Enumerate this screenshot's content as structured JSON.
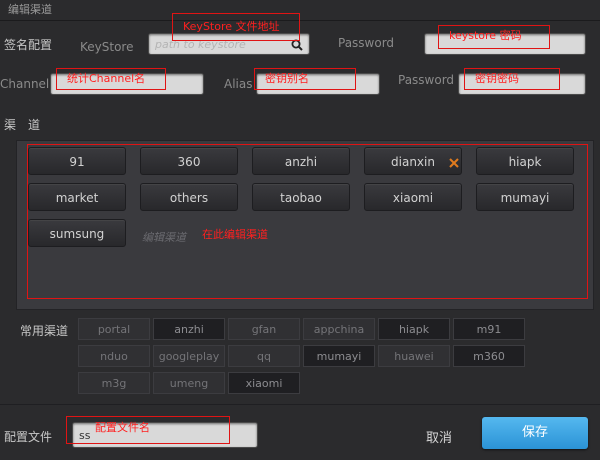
{
  "window": {
    "title": "编辑渠道"
  },
  "signing": {
    "section_label": "签名配置",
    "keystore_label": "KeyStore",
    "keystore_placeholder": "path to keystore",
    "keystore_annotation": "KeyStore 文件地址",
    "password_label": "Password",
    "password_annotation": "keystore 密码",
    "channel_label": "Channel",
    "channel_annotation": "统计Channel名",
    "alias_label": "Alias",
    "alias_annotation": "密钥别名",
    "alias_password_label": "Password",
    "alias_password_annotation": "密钥密码"
  },
  "channels": {
    "section_label": "渠　道",
    "items": [
      "91",
      "360",
      "anzhi",
      "dianxin",
      "hiapk",
      "market",
      "others",
      "taobao",
      "xiaomi",
      "mumayi",
      "sumsung"
    ],
    "edit_placeholder": "编辑渠道",
    "edit_annotation": "在此编辑渠道",
    "remove_icon": "close-icon",
    "remove_color": "#e07b1e"
  },
  "common": {
    "label": "常用渠道",
    "items": [
      {
        "name": "portal",
        "style": "light"
      },
      {
        "name": "anzhi",
        "style": "dark"
      },
      {
        "name": "gfan",
        "style": "light"
      },
      {
        "name": "appchina",
        "style": "light"
      },
      {
        "name": "hiapk",
        "style": "dark"
      },
      {
        "name": "m91",
        "style": "dark"
      },
      {
        "name": "nduo",
        "style": "light"
      },
      {
        "name": "googleplay",
        "style": "light"
      },
      {
        "name": "qq",
        "style": "light"
      },
      {
        "name": "mumayi",
        "style": "dark"
      },
      {
        "name": "huawei",
        "style": "light"
      },
      {
        "name": "m360",
        "style": "dark"
      },
      {
        "name": "m3g",
        "style": "light"
      },
      {
        "name": "umeng",
        "style": "light"
      },
      {
        "name": "xiaomi",
        "style": "dark"
      }
    ]
  },
  "footer": {
    "config_label": "配置文件",
    "config_value": "ss",
    "config_annotation": "配置文件名",
    "cancel_label": "取消",
    "save_label": "保存",
    "save_color": "#3aa3e3"
  }
}
